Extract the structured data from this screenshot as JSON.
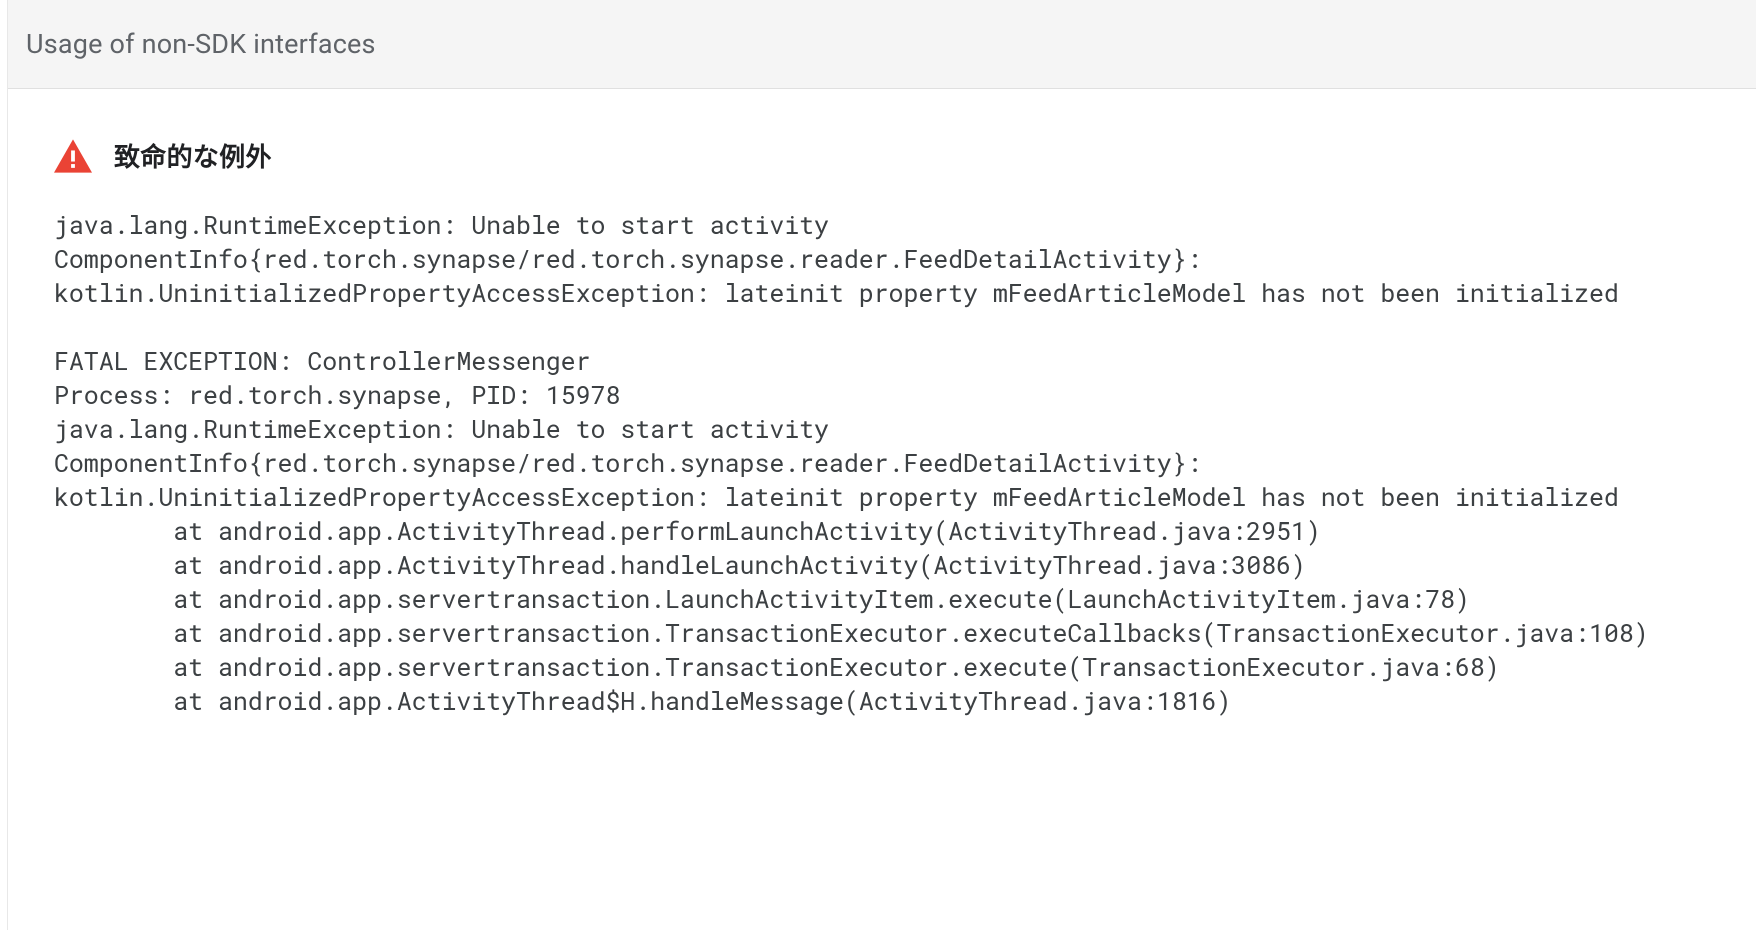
{
  "header": {
    "title": "Usage of non-SDK interfaces"
  },
  "exception": {
    "label": "致命的な例外",
    "summary": "java.lang.RuntimeException: Unable to start activity ComponentInfo{red.torch.synapse/red.torch.synapse.reader.FeedDetailActivity}: kotlin.UninitializedPropertyAccessException: lateinit property mFeedArticleModel has not been initialized",
    "body": "FATAL EXCEPTION: ControllerMessenger\nProcess: red.torch.synapse, PID: 15978\njava.lang.RuntimeException: Unable to start activity ComponentInfo{red.torch.synapse/red.torch.synapse.reader.FeedDetailActivity}: kotlin.UninitializedPropertyAccessException: lateinit property mFeedArticleModel has not been initialized\n        at android.app.ActivityThread.performLaunchActivity(ActivityThread.java:2951)\n        at android.app.ActivityThread.handleLaunchActivity(ActivityThread.java:3086)\n        at android.app.servertransaction.LaunchActivityItem.execute(LaunchActivityItem.java:78)\n        at android.app.servertransaction.TransactionExecutor.executeCallbacks(TransactionExecutor.java:108)\n        at android.app.servertransaction.TransactionExecutor.execute(TransactionExecutor.java:68)\n        at android.app.ActivityThread$H.handleMessage(ActivityThread.java:1816)"
  },
  "colors": {
    "warning_icon": "#ea4335",
    "header_bg": "#f5f5f5",
    "text_muted": "#5f6368",
    "text_body": "#3c4043"
  }
}
